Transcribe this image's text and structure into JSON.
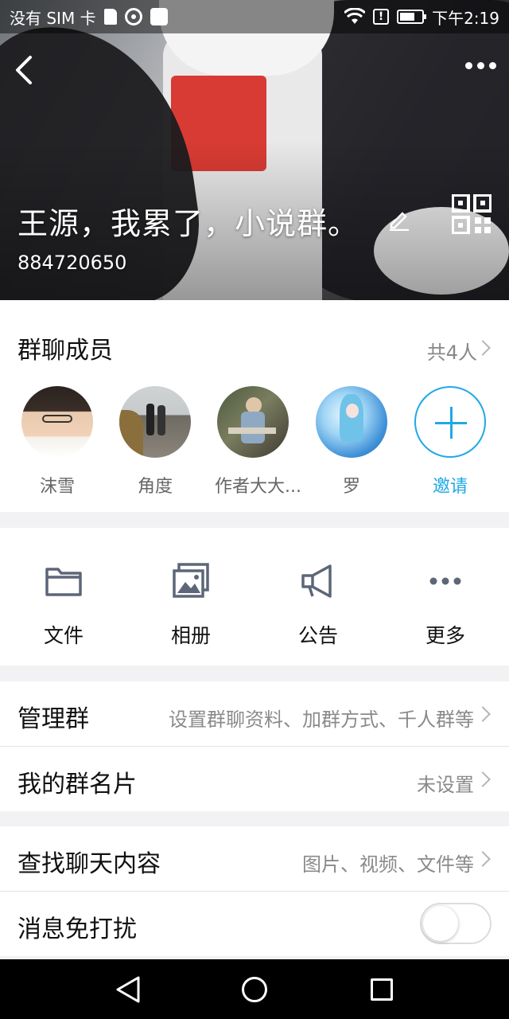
{
  "status_bar": {
    "carrier": "没有 SIM 卡",
    "time": "下午2:19"
  },
  "header": {
    "group_name": "王源，我累了，小说群。",
    "group_id": "884720650"
  },
  "members": {
    "title": "群聊成员",
    "count": "共4人",
    "list": [
      {
        "name": "沫雪"
      },
      {
        "name": "角度"
      },
      {
        "name": "作者大大..."
      },
      {
        "name": "罗"
      }
    ],
    "invite_label": "邀请"
  },
  "features": [
    {
      "label": "文件",
      "icon": "folder-icon"
    },
    {
      "label": "相册",
      "icon": "photo-album-icon"
    },
    {
      "label": "公告",
      "icon": "megaphone-icon"
    },
    {
      "label": "更多",
      "icon": "more-icon"
    }
  ],
  "settings": {
    "manage": {
      "label": "管理群",
      "value": "设置群聊资料、加群方式、千人群等"
    },
    "card": {
      "label": "我的群名片",
      "value": "未设置"
    },
    "search": {
      "label": "查找聊天内容",
      "value": "图片、视频、文件等"
    },
    "mute": {
      "label": "消息免打扰",
      "enabled": false
    }
  },
  "colors": {
    "accent": "#1fa9e6",
    "icon_gray": "#5d6678"
  }
}
